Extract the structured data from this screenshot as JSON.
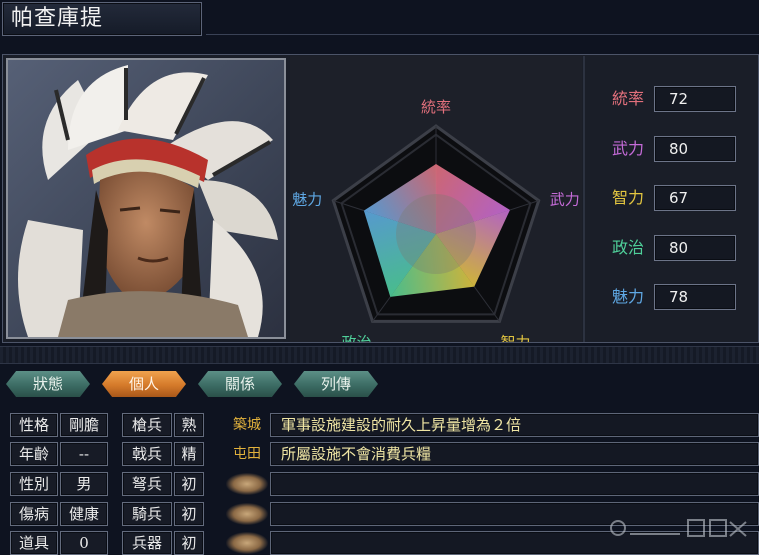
{
  "officer": {
    "name": "帕查庫提"
  },
  "portrait": {
    "alt": "portrait"
  },
  "radar": {
    "axes": [
      {
        "label": "統率",
        "value": 72,
        "color": "#e2707c"
      },
      {
        "label": "武力",
        "value": 80,
        "color": "#c56bd8"
      },
      {
        "label": "智力",
        "value": 67,
        "color": "#e3c640"
      },
      {
        "label": "政治",
        "value": 80,
        "color": "#4fd09a"
      },
      {
        "label": "魅力",
        "value": 78,
        "color": "#5fa8e4"
      }
    ],
    "max": 100
  },
  "stats": [
    {
      "label": "統率",
      "value": "72",
      "color": "#e2707c"
    },
    {
      "label": "武力",
      "value": "80",
      "color": "#c56bd8"
    },
    {
      "label": "智力",
      "value": "67",
      "color": "#e3c640"
    },
    {
      "label": "政治",
      "value": "80",
      "color": "#4fd09a"
    },
    {
      "label": "魅力",
      "value": "78",
      "color": "#5fa8e4"
    }
  ],
  "tabs": [
    {
      "label": "狀態",
      "active": false
    },
    {
      "label": "個人",
      "active": true
    },
    {
      "label": "關係",
      "active": false
    },
    {
      "label": "列傳",
      "active": false
    }
  ],
  "personal": [
    {
      "label": "性格",
      "value": "剛膽"
    },
    {
      "label": "年齡",
      "value": "--"
    },
    {
      "label": "性別",
      "value": "男"
    },
    {
      "label": "傷病",
      "value": "健康"
    },
    {
      "label": "道具",
      "value": "0"
    }
  ],
  "aptitude": [
    {
      "label": "槍兵",
      "value": "熟"
    },
    {
      "label": "戟兵",
      "value": "精"
    },
    {
      "label": "弩兵",
      "value": "初"
    },
    {
      "label": "騎兵",
      "value": "初"
    },
    {
      "label": "兵器",
      "value": "初"
    }
  ],
  "skills": [
    {
      "name": "築城",
      "desc": "軍事設施建設的耐久上昇量增為２倍"
    },
    {
      "name": "屯田",
      "desc": "所屬設施不會消費兵糧"
    },
    {
      "name": "",
      "desc": ""
    },
    {
      "name": "",
      "desc": ""
    },
    {
      "name": "",
      "desc": ""
    }
  ]
}
